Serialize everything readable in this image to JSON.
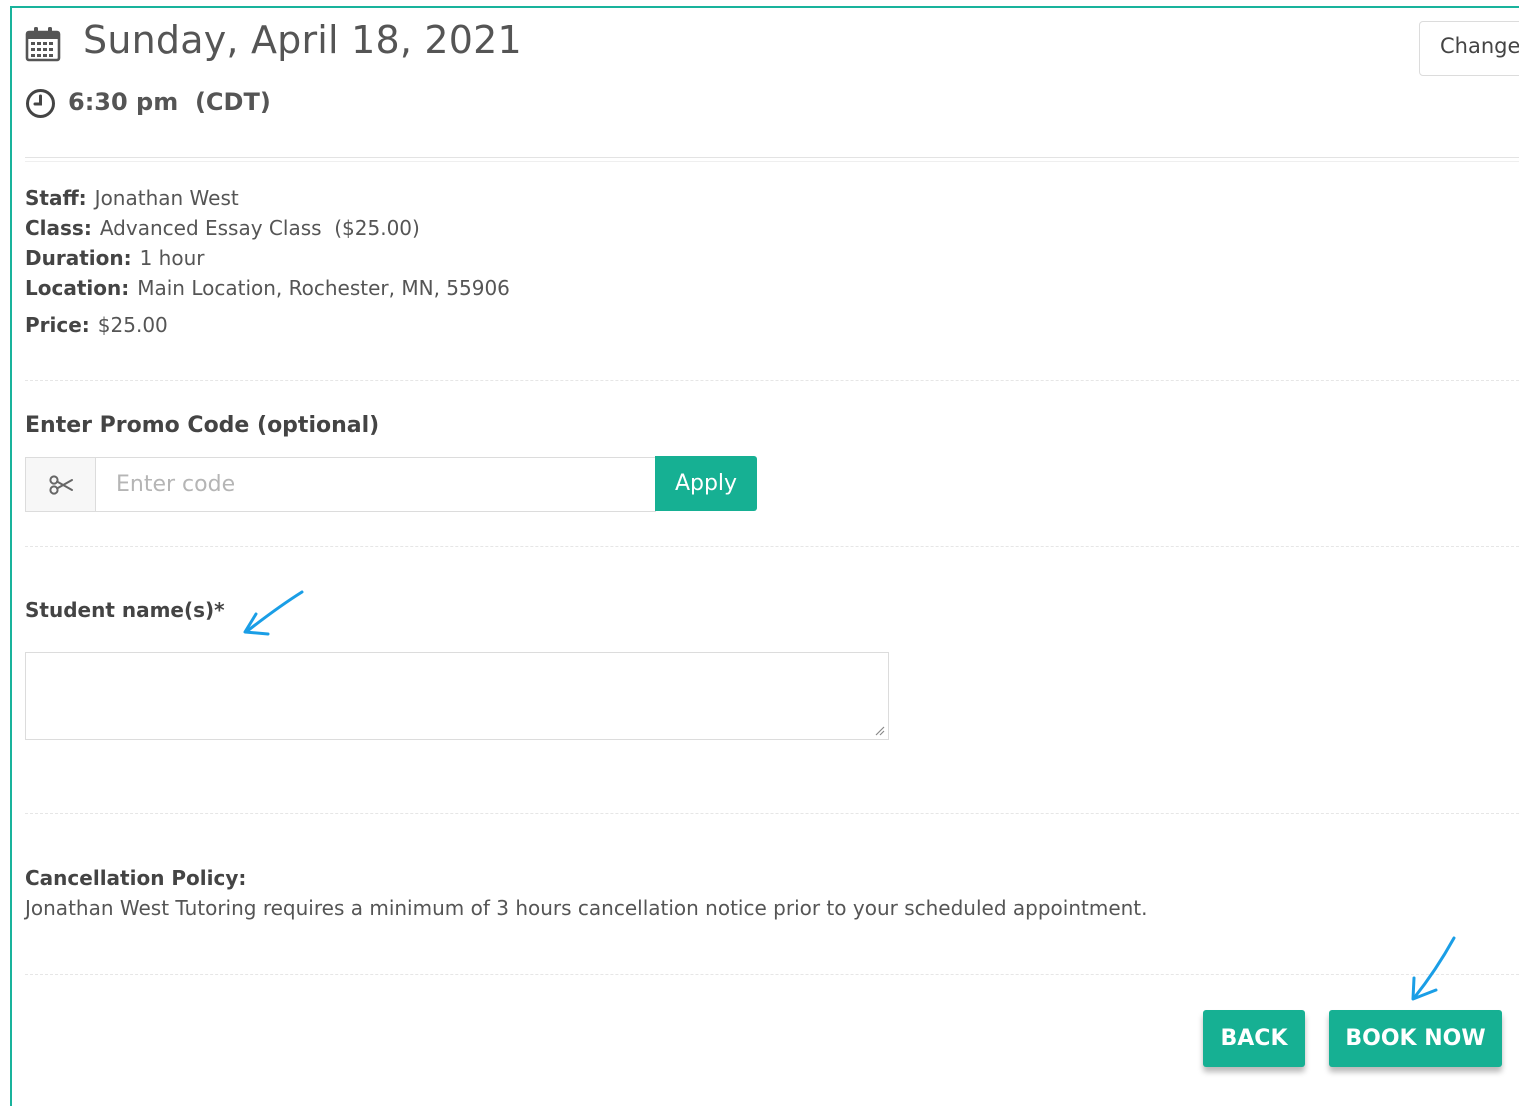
{
  "header": {
    "date": "Sunday, April 18, 2021",
    "time": "6:30 pm  (CDT)",
    "change_label": "Change"
  },
  "details": {
    "staff_label": "Staff:",
    "staff_value": "Jonathan West",
    "class_label": "Class:",
    "class_value": "Advanced Essay Class  ($25.00)",
    "duration_label": "Duration:",
    "duration_value": "1 hour",
    "location_label": "Location:",
    "location_value": "Main Location, Rochester, MN, 55906",
    "price_label": "Price:",
    "price_value": "$25.00"
  },
  "promo": {
    "label": "Enter Promo Code (optional)",
    "placeholder": "Enter code",
    "value": "",
    "apply_label": "Apply"
  },
  "student": {
    "label": "Student name(s)*",
    "value": ""
  },
  "policy": {
    "title": "Cancellation Policy:",
    "text": "Jonathan West Tutoring requires a minimum of 3 hours cancellation notice prior to your scheduled appointment."
  },
  "actions": {
    "back_label": "BACK",
    "book_label": "BOOK NOW"
  },
  "colors": {
    "accent": "#16b093",
    "frame_border": "#19b39c",
    "annotation_arrow": "#1a9ee6"
  },
  "icons": {
    "date": "calendar-icon",
    "time": "clock-icon",
    "promo": "scissors-icon",
    "annotations": "arrow-icon"
  }
}
